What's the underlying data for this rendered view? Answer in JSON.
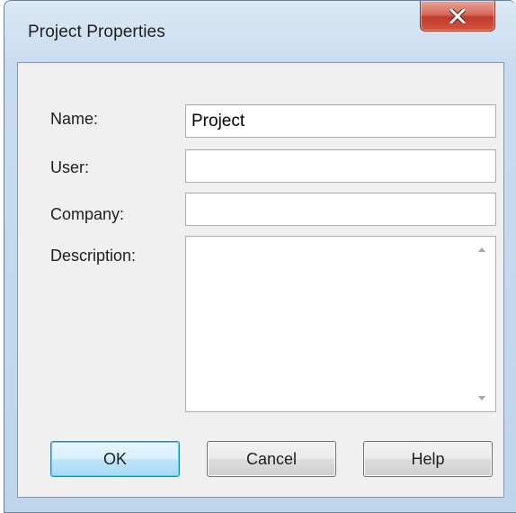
{
  "window": {
    "title": "Project Properties"
  },
  "form": {
    "name_label": "Name:",
    "name_value": "Project",
    "user_label": "User:",
    "user_value": "",
    "company_label": "Company:",
    "company_value": "",
    "description_label": "Description:",
    "description_value": ""
  },
  "buttons": {
    "ok": "OK",
    "cancel": "Cancel",
    "help": "Help"
  },
  "icons": {
    "close": "close-icon",
    "scroll_up": "scroll-up-arrow-icon",
    "scroll_down": "scroll-down-arrow-icon"
  }
}
